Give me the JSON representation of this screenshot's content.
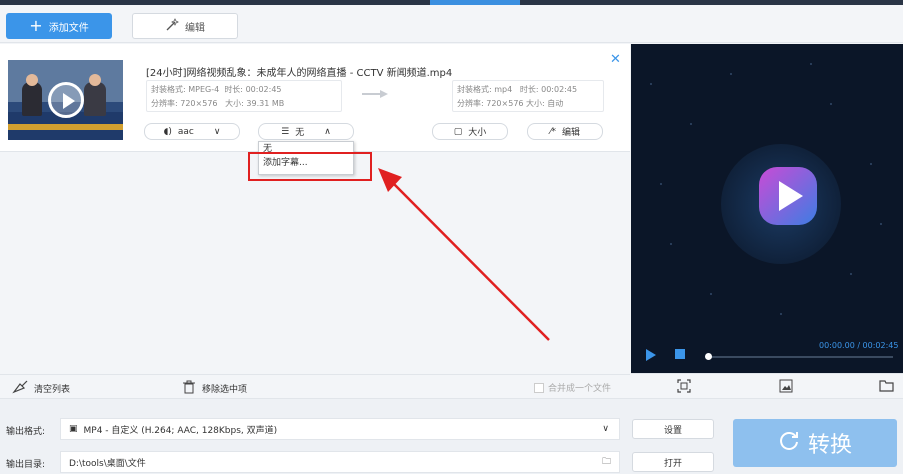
{
  "toolbar": {
    "add_file_label": "添加文件",
    "edit_label": "编辑"
  },
  "file": {
    "name": "[24小时]网络视频乱象：未成年人的网络直播 - CCTV 新闻频道.mp4",
    "source": {
      "format_label": "封装格式:",
      "format": "MPEG-4",
      "duration_label": "时长:",
      "duration": "00:02:45",
      "resolution_label": "分辨率:",
      "resolution": "720×576",
      "size_label": "大小:",
      "size": "39.31 MB"
    },
    "target": {
      "format_label": "封装格式:",
      "format": "mp4",
      "duration_label": "时长:",
      "duration": "00:02:45",
      "resolution_label": "分辨率:",
      "resolution": "720×576",
      "size_label": "大小:",
      "size": "自动"
    },
    "audio_label": "aac",
    "subtitle_label": "无",
    "size_button": "大小",
    "edit_button": "编辑"
  },
  "subtitle_dropdown": {
    "options": [
      "无",
      "添加字幕..."
    ]
  },
  "list_actions": {
    "clear_label": "清空列表",
    "remove_label": "移除选中项",
    "merge_label": "合并成一个文件"
  },
  "player": {
    "time": "00:00.00 / 00:02:45",
    "progress": 0
  },
  "footer": {
    "format_label": "输出格式:",
    "format_value": "MP4 - 自定义 (H.264; AAC, 128Kbps, 双声道)",
    "settings_label": "设置",
    "dir_label": "输出目录:",
    "dir_value": "D:\\tools\\桌面\\文件",
    "open_label": "打开",
    "convert_label": "转换"
  },
  "colors": {
    "accent": "#3b95e9",
    "convert": "#8ec0ee",
    "highlight": "#e02020",
    "preview_bg": "#0b1628"
  }
}
